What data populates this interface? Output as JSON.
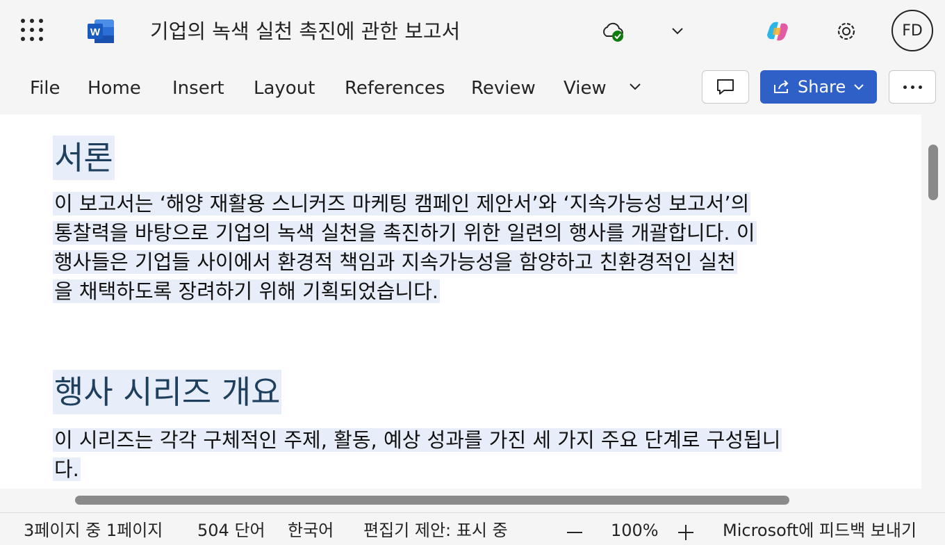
{
  "titlebar": {
    "doc_title": "기업의 녹색 실천 촉진에 관한 보고서",
    "avatar_initials": "FD",
    "app_logo_letter": "W"
  },
  "ribbon": {
    "tabs": [
      "File",
      "Home",
      "Insert",
      "Layout",
      "References",
      "Review",
      "View"
    ],
    "share_label": "Share"
  },
  "document": {
    "heading1": "서론",
    "para1_lines": [
      "이 보고서는 ‘해양 재활용 스니커즈 마케팅 캠페인 제안서’와 ‘지속가능성 보고서’의",
      "통찰력을 바탕으로 기업의 녹색 실천을 촉진하기 위한 일련의 행사를 개괄합니다. 이",
      "행사들은 기업들 사이에서 환경적 책임과 지속가능성을 함양하고 친환경적인 실천",
      "을 채택하도록 장려하기 위해 기획되었습니다."
    ],
    "heading2": "행사 시리즈 개요",
    "para2_lines": [
      "이 시리즈는 각각 구체적인 주제, 활동, 예상 성과를 가진 세 가지 주요 단계로 구성됩니",
      "다."
    ]
  },
  "statusbar": {
    "page_info": "3페이지 중 1페이지",
    "word_count": "504 단어",
    "language": "한국어",
    "editor_status": "편집기 제안: 표시 중",
    "zoom": "100%",
    "feedback": "Microsoft에 피드백 보내기"
  },
  "colors": {
    "accent": "#2f60c8",
    "heading": "#1f3f5e",
    "highlight": "#e8eef9",
    "word_blue": "#185abd",
    "sync_green": "#107c10"
  },
  "icons": [
    "app-launcher-icon",
    "word-logo-icon",
    "cloud-saved-icon",
    "chevron-down-icon",
    "copilot-icon",
    "settings-icon",
    "comment-icon",
    "share-icon",
    "more-icon"
  ]
}
